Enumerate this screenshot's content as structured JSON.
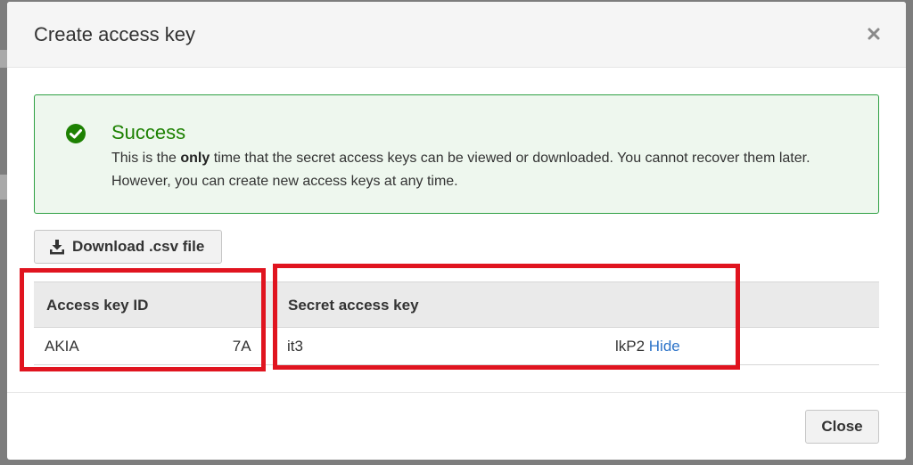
{
  "modal": {
    "title": "Create access key",
    "close_glyph": "×"
  },
  "alert": {
    "title": "Success",
    "body_before": "This is the ",
    "body_bold": "only",
    "body_after": " time that the secret access keys can be viewed or downloaded. You cannot recover them later. However, you can create new access keys at any time.",
    "icon": "check-circle-icon",
    "color": "#1d8102"
  },
  "download_button": {
    "label": "Download .csv file",
    "icon": "download-icon"
  },
  "table": {
    "headers": [
      "Access key ID",
      "Secret access key"
    ],
    "row": {
      "access_key_prefix": "AKIA",
      "access_key_suffix": "7A",
      "secret_prefix": "it3",
      "secret_suffix": "lkP2",
      "hide_link": "Hide"
    }
  },
  "footer": {
    "close_label": "Close"
  },
  "colors": {
    "highlight": "#e0141f",
    "link": "#2c73c8",
    "success": "#1d8102"
  }
}
